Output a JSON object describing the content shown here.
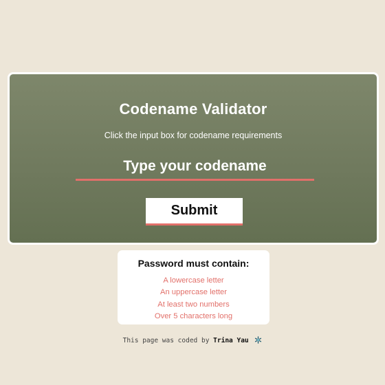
{
  "card": {
    "title": "Codename Validator",
    "subtitle": "Click the input box for codename requirements",
    "input": {
      "placeholder": "Type your codename",
      "value": ""
    },
    "submit_label": "Submit"
  },
  "requirements": {
    "title": "Password must contain:",
    "items": [
      "A lowercase letter",
      "An uppercase letter",
      "At least two numbers",
      "Over 5 characters long"
    ]
  },
  "footer": {
    "text": "This page was coded by",
    "author": "Trina Yau",
    "icon": "snowflake-icon"
  },
  "colors": {
    "background": "#ede6d8",
    "card_green": "#76806a",
    "accent_coral": "#e2706a"
  }
}
